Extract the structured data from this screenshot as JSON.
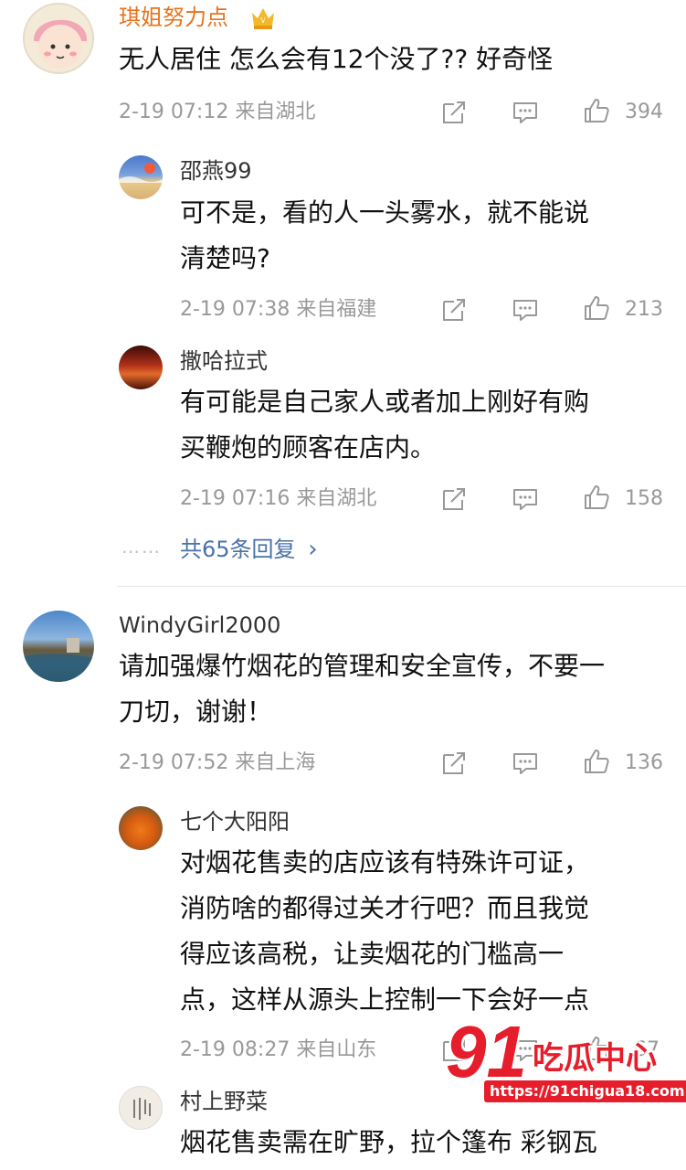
{
  "comments": [
    {
      "name": "琪姐努力点",
      "text_lines": [
        "无人居住 怎么会有12个没了?? 好奇怪"
      ],
      "meta": "2-19 07:12 来自湖北",
      "likes": "394"
    },
    {
      "name": "WindyGirl2000",
      "text_lines": [
        "请加强爆竹烟花的管理和安全宣传，不要一",
        "刀切，谢谢！"
      ],
      "meta": "2-19 07:52 来自上海",
      "likes": "136"
    }
  ],
  "replies": [
    {
      "name": "邵燕99",
      "text_lines": [
        "可不是，看的人一头雾水，就不能说",
        "清楚吗?"
      ],
      "meta": "2-19 07:38 来自福建",
      "likes": "213"
    },
    {
      "name": "撒哈拉式",
      "text_lines": [
        "有可能是自己家人或者加上刚好有购",
        "买鞭炮的顾客在店内。"
      ],
      "meta": "2-19 07:16 来自湖北",
      "likes": "158"
    },
    {
      "name": "七个大阳阳",
      "text_lines": [
        "对烟花售卖的店应该有特殊许可证，",
        "消防啥的都得过关才行吧？而且我觉",
        "得应该高税，让卖烟花的门槛高一",
        "点，这样从源头上控制一下会好一点"
      ],
      "meta": "2-19 08:27 来自山东",
      "likes": "67"
    },
    {
      "name": "村上野菜",
      "text_lines": [
        "烟花售卖需在旷野，拉个篷布 彩钢瓦"
      ]
    }
  ],
  "more_replies": "共65条回复",
  "more_dots": "……",
  "more_chevron": "›",
  "watermark": {
    "brand_number": "91",
    "brand_text": "吃瓜中心",
    "url": "https://91chigua18.com"
  },
  "colors": {
    "vip_name": "#e8731c",
    "link": "#4a72a8",
    "meta": "#999999",
    "watermark_red": "#e61e2b"
  },
  "icons": [
    "crown-icon",
    "share-icon",
    "comment-icon",
    "like-icon",
    "chevron-right-icon"
  ]
}
